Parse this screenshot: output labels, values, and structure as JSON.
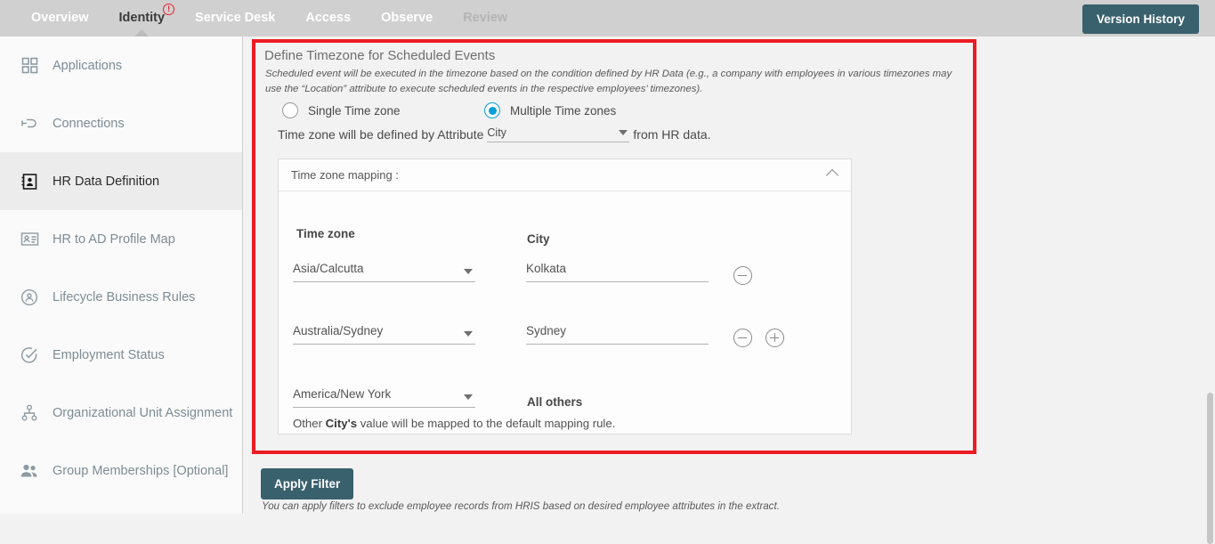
{
  "topnav": {
    "tabs": [
      {
        "label": "Overview",
        "state": "normal"
      },
      {
        "label": "Identity",
        "state": "active",
        "badge": "!"
      },
      {
        "label": "Service Desk",
        "state": "normal"
      },
      {
        "label": "Access",
        "state": "normal"
      },
      {
        "label": "Observe",
        "state": "normal"
      },
      {
        "label": "Review",
        "state": "dim"
      }
    ],
    "version_history_label": "Version History",
    "accent_color": "#39606d",
    "bar_color": "#d0d0d0",
    "badge_color": "#e8202a"
  },
  "sidebar": {
    "items": [
      {
        "label": "Applications",
        "icon": "grid-icon",
        "selected": false
      },
      {
        "label": "Connections",
        "icon": "plug-icon",
        "selected": false
      },
      {
        "label": "HR Data Definition",
        "icon": "contact-card-icon",
        "selected": true
      },
      {
        "label": "HR to AD Profile Map",
        "icon": "id-card-icon",
        "selected": false
      },
      {
        "label": "Lifecycle Business Rules",
        "icon": "lifecycle-icon",
        "selected": false
      },
      {
        "label": "Employment Status",
        "icon": "check-circle-icon",
        "selected": false
      },
      {
        "label": "Organizational Unit Assignment",
        "icon": "org-tree-icon",
        "selected": false
      },
      {
        "label": "Group Memberships [Optional]",
        "icon": "people-icon",
        "selected": false
      }
    ]
  },
  "main": {
    "highlight_color": "#ec1c24",
    "panel_title": "Define Timezone for Scheduled Events",
    "panel_description": "Scheduled event will be executed in the timezone based on the condition defined by HR Data (e.g., a company with employees in various timezones may use the “Location” attribute to execute scheduled events in the respective employees’ timezones).",
    "radio": {
      "single_label": "Single Time zone",
      "multiple_label": "Multiple Time zones",
      "selected": "multiple",
      "selected_color": "#0a9fd8"
    },
    "attribute_row": {
      "lead_text": "Time zone will be defined by Attribute",
      "selected_attribute": "City",
      "tail_text": "from HR data."
    },
    "mapping_card": {
      "header_label": "Time zone mapping :",
      "collapse_icon": "chevron-up-icon",
      "columns": {
        "timezone": "Time zone",
        "city": "City"
      },
      "rows": [
        {
          "timezone": "Asia/Calcutta",
          "city": "Kolkata",
          "has_remove": true,
          "has_add": false
        },
        {
          "timezone": "Australia/Sydney",
          "city": "Sydney",
          "has_remove": true,
          "has_add": true
        },
        {
          "timezone": "America/New York",
          "city": "All others",
          "has_remove": false,
          "has_add": false
        }
      ],
      "default_note_prefix": "Other ",
      "default_note_bold": "City's",
      "default_note_suffix": " value will be mapped to the default mapping rule."
    },
    "footer": {
      "apply_filter_label": "Apply Filter",
      "apply_filter_note": "You can apply filters to exclude employee records from HRIS based on desired employee attributes in the extract."
    }
  }
}
